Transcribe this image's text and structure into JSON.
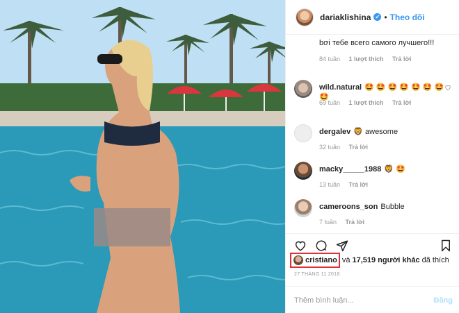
{
  "header": {
    "username": "dariaklishina",
    "verified_glyph": "✔",
    "separator": "•",
    "follow_label": "Theo dõi"
  },
  "caption_tail": {
    "text": "bơi тебе всего самого лучшего!!!",
    "meta": {
      "time": "84 tuần",
      "likes": "1 lượt thích",
      "reply": "Trả lời"
    }
  },
  "comments": [
    {
      "username": "wild.natural",
      "text": "🤩 🤩 🤩 🤩 🤩 🤩 🤩 🤩",
      "time": "69 tuần",
      "likes": "1 lượt thích",
      "reply": "Trả lời"
    },
    {
      "username": "dergalev",
      "text": "🦁 awesome",
      "time": "32 tuần",
      "reply": "Trả lời"
    },
    {
      "username": "macky_____1988",
      "text": "🦁 🤩",
      "time": "13 tuần",
      "reply": "Trả lời"
    },
    {
      "username": "cameroons_son",
      "text": "Bubble",
      "time": "7 tuần",
      "reply": "Trả lời"
    }
  ],
  "likes": {
    "first_user": "cristiano",
    "rest_prefix": "và",
    "count": "17,519 người khác",
    "rest_suffix": "đã thích"
  },
  "date": "27 THÁNG 11 2018",
  "add_comment": {
    "placeholder": "Thêm bình luận...",
    "post_label": "Đăng"
  },
  "icons": [
    "heart-icon",
    "comment-icon",
    "share-icon",
    "bookmark-icon",
    "verified-badge-icon",
    "small-heart-icon"
  ],
  "colors": {
    "link_blue": "#3897f0",
    "highlight_red": "#e0303a",
    "muted_gray": "#999999",
    "border": "#efefef"
  }
}
